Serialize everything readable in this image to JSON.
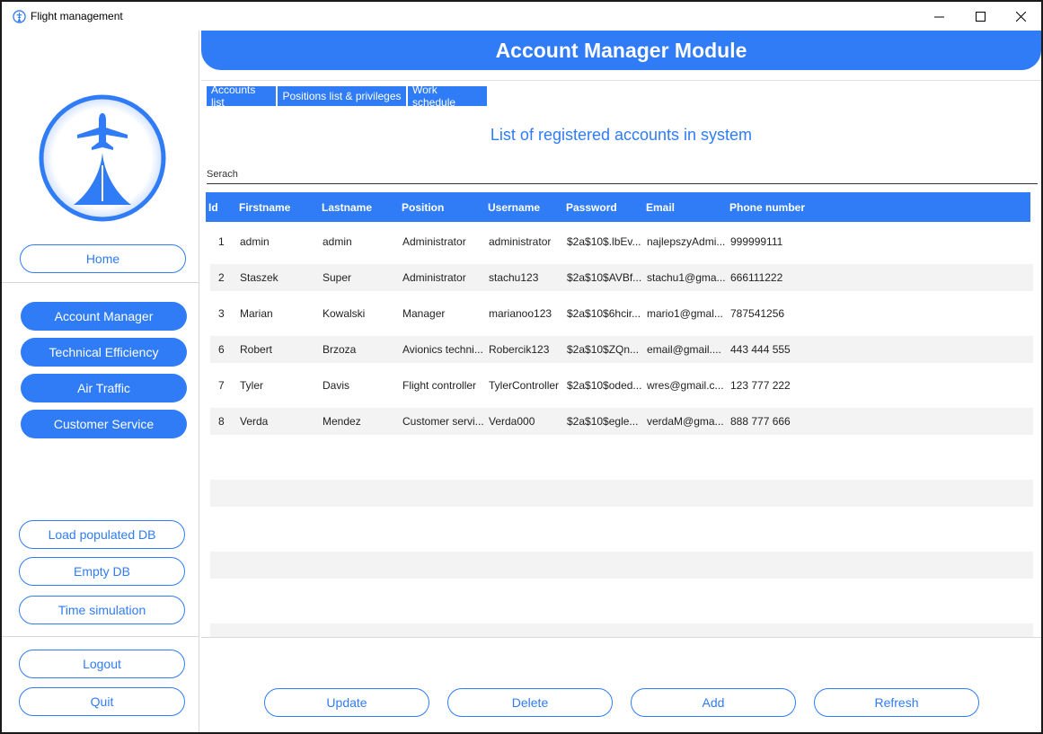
{
  "window": {
    "title": "Flight management"
  },
  "colors": {
    "accent": "#2f7cf6"
  },
  "sidebar": {
    "home_label": "Home",
    "nav": [
      {
        "label": "Account Manager"
      },
      {
        "label": "Technical Efficiency"
      },
      {
        "label": "Air Traffic"
      },
      {
        "label": "Customer Service"
      }
    ],
    "db": [
      {
        "label": "Load populated DB"
      },
      {
        "label": "Empty DB"
      },
      {
        "label": "Time simulation"
      }
    ],
    "logout_label": "Logout",
    "quit_label": "Quit"
  },
  "header": {
    "title": "Account Manager Module"
  },
  "tabs": [
    {
      "label": "Accounts list"
    },
    {
      "label": "Positions list & privileges"
    },
    {
      "label": "Work schedule"
    }
  ],
  "main": {
    "subtitle": "List of registered accounts in system",
    "search_label": "Serach"
  },
  "table": {
    "columns": [
      "Id",
      "Firstname",
      "Lastname",
      "Position",
      "Username",
      "Password",
      "Email",
      "Phone number"
    ],
    "rows": [
      [
        "1",
        "admin",
        "admin",
        "Administrator",
        "administrator",
        "$2a$10$.lbEv...",
        "najlepszyAdmi...",
        "999999111"
      ],
      [
        "2",
        "Staszek",
        "Super",
        "Administrator",
        "stachu123",
        "$2a$10$AVBf...",
        "stachu1@gma...",
        "666111222"
      ],
      [
        "3",
        "Marian",
        "Kowalski",
        "Manager",
        "marianoo123",
        "$2a$10$6hcir...",
        "mario1@gmal...",
        "787541256"
      ],
      [
        "6",
        "Robert",
        "Brzoza",
        "Avionics techni...",
        "Robercik123",
        "$2a$10$ZQn...",
        "email@gmail....",
        "443 444 555"
      ],
      [
        "7",
        "Tyler",
        "Davis",
        "Flight controller",
        "TylerController",
        "$2a$10$oded...",
        "wres@gmail.c...",
        "123 777 222"
      ],
      [
        "8",
        "Verda",
        "Mendez",
        "Customer servi...",
        "Verda000",
        "$2a$10$egle...",
        "verdaM@gma...",
        "888 777 666"
      ]
    ]
  },
  "actions": {
    "update_label": "Update",
    "delete_label": "Delete",
    "add_label": "Add",
    "refresh_label": "Refresh"
  }
}
